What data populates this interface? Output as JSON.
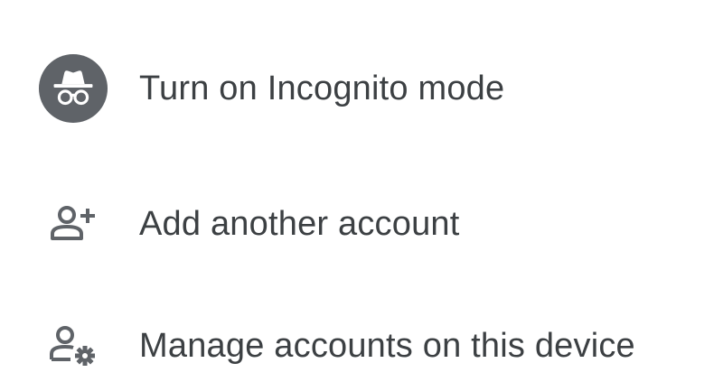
{
  "menu": {
    "items": [
      {
        "icon": "incognito-icon",
        "label": "Turn on Incognito mode"
      },
      {
        "icon": "add-person-icon",
        "label": "Add another account"
      },
      {
        "icon": "manage-accounts-icon",
        "label": "Manage accounts on this device"
      }
    ]
  },
  "colors": {
    "icon": "#5f6368",
    "text": "#3c4043",
    "background": "#ffffff"
  }
}
